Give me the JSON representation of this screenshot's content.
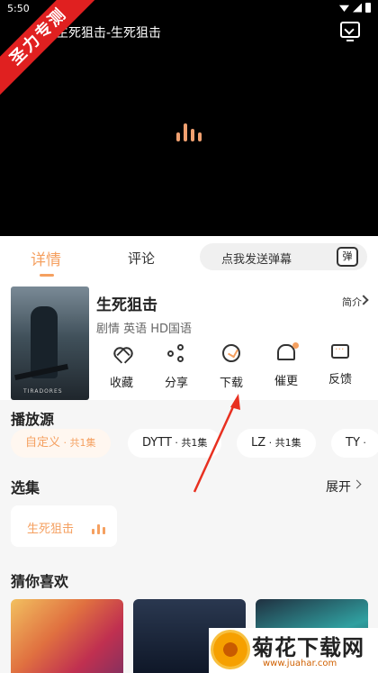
{
  "status_bar": {
    "time": "5:50"
  },
  "player": {
    "title": "生死狙击-生死狙击"
  },
  "ribbon": {
    "text": "圣力专测"
  },
  "tabs": {
    "detail": "详情",
    "comment": "评论",
    "danmu_placeholder": "点我发送弹幕",
    "danmu_button": "弹"
  },
  "movie": {
    "poster_text": "TIRADORES",
    "title": "生死狙击",
    "tags": "剧情 英语 HD国语",
    "intro_label": "简介"
  },
  "actions": [
    {
      "label": "收藏",
      "icon": "heart-icon"
    },
    {
      "label": "分享",
      "icon": "share-icon"
    },
    {
      "label": "下载",
      "icon": "download-icon"
    },
    {
      "label": "催更",
      "icon": "bell-icon"
    },
    {
      "label": "反馈",
      "icon": "feedback-icon"
    }
  ],
  "sources": {
    "title": "播放源",
    "items": [
      {
        "name": "自定义",
        "count": " · 共1集"
      },
      {
        "name": "DYTT",
        "count": " · 共1集"
      },
      {
        "name": "LZ",
        "count": " · 共1集"
      },
      {
        "name": "TY",
        "count": " · "
      }
    ]
  },
  "episodes": {
    "title": "选集",
    "expand": "展开",
    "current": "生死狙击"
  },
  "recommend": {
    "title": "猜你喜欢"
  },
  "watermark": {
    "name": "菊花下载网",
    "url": "www.juahar.com"
  },
  "colors": {
    "accent": "#f5a060",
    "ribbon": "#e02020",
    "annotation": "#e83020"
  }
}
